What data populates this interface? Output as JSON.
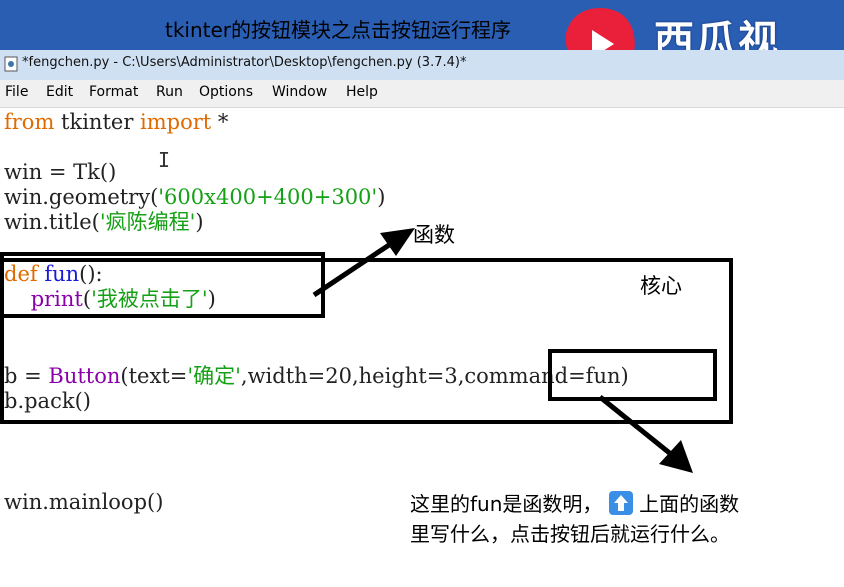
{
  "banner": {
    "title": "tkinter的按钮模块之点击按钮运行程序",
    "logo_text": "西瓜视"
  },
  "window": {
    "title": "*fengchen.py - C:\\Users\\Administrator\\Desktop\\fengchen.py (3.7.4)*"
  },
  "menu": {
    "items": [
      "File",
      "Edit",
      "Format",
      "Run",
      "Options",
      "Window",
      "Help"
    ]
  },
  "code": {
    "l1_kw": "from",
    "l1_mod": " tkinter ",
    "l1_kw2": "import",
    "l1_star": " *",
    "l2": "win = Tk()",
    "l3_a": "win.geometry(",
    "l3_s": "'600x400+400+300'",
    "l3_b": ")",
    "l4_a": "win.title(",
    "l4_s": "'疯陈编程'",
    "l4_b": ")",
    "l5_kw": "def",
    "l5_fn": " fun",
    "l5_b": "():",
    "l6_bi": "    print",
    "l6_a": "(",
    "l6_s": "'我被点击了'",
    "l6_b": ")",
    "l7_a": "b = ",
    "l7_bi": "Button",
    "l7_b": "(text=",
    "l7_s": "'确定'",
    "l7_c": ",width=20,height=3,command=fun)",
    "l8": "b.pack()",
    "l9": "win.mainloop()"
  },
  "annotations": {
    "func": "函数",
    "core": "核心",
    "note_line1": "这里的fun是函数明，",
    "note_line1b": "上面的函数",
    "note_line2": "里写什么，点击按钮后就运行什么。"
  },
  "colors": {
    "banner": "#2a5eb3",
    "keyword": "#e06a00",
    "builtin": "#8a00a8",
    "string": "#15a015",
    "funcname": "#1a1ad8"
  }
}
